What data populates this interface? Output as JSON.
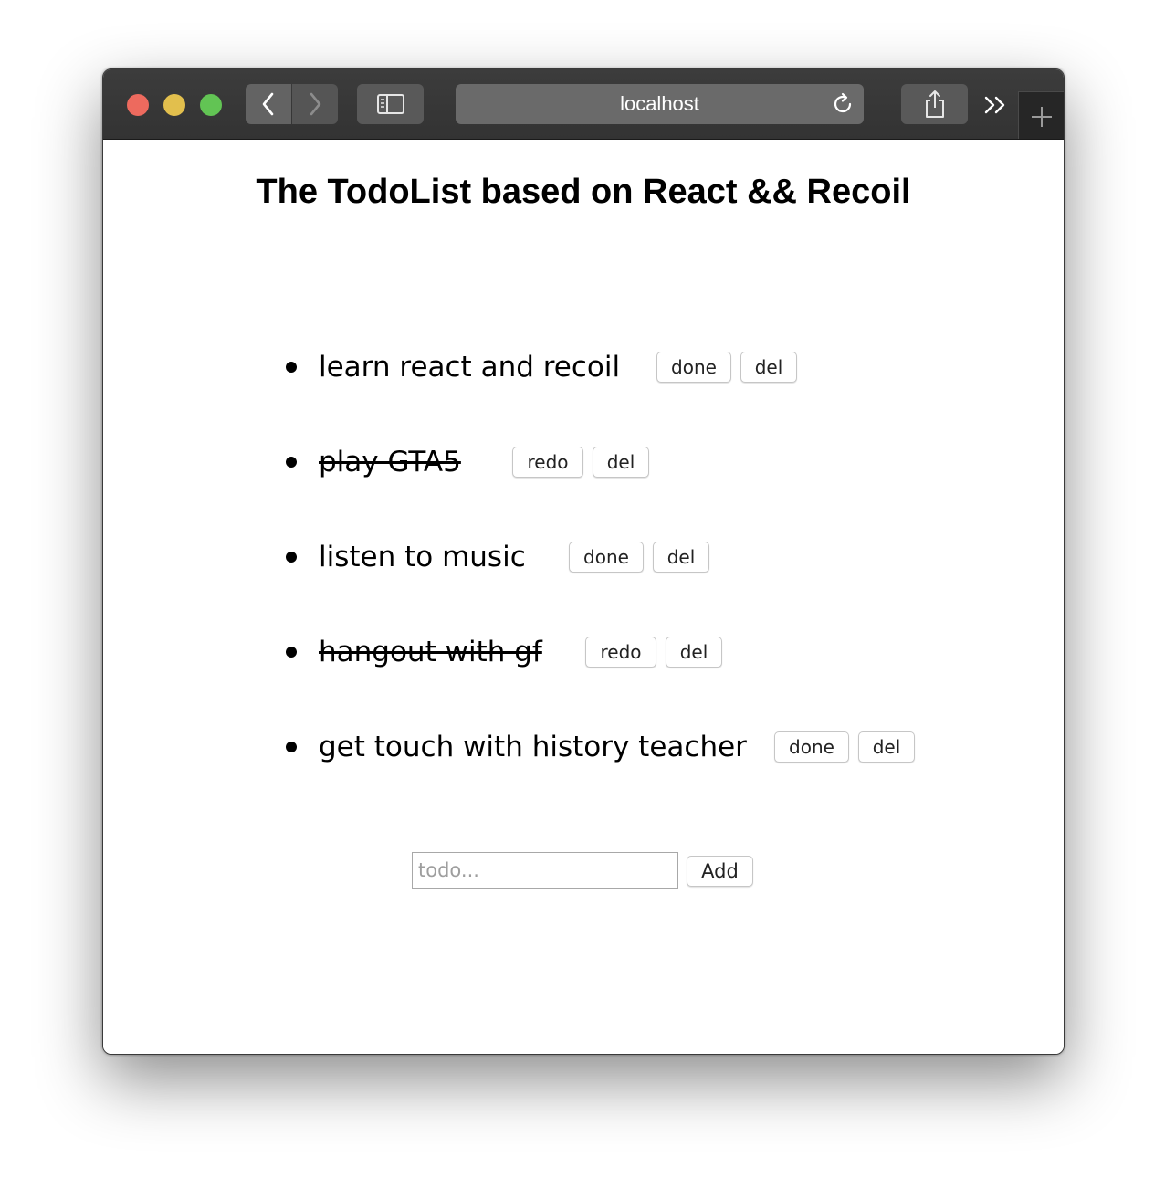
{
  "browser": {
    "url": "localhost",
    "icons": {
      "back": "chevron-left-icon",
      "forward": "chevron-right-icon",
      "sidebar": "sidebar-icon",
      "reload": "reload-icon",
      "share": "share-icon",
      "more": "double-chevron-icon",
      "new_tab": "plus-icon"
    },
    "colors": {
      "close": "#ed6a5e",
      "minimize": "#e2bf4d",
      "zoom": "#62c454"
    }
  },
  "page": {
    "title": "The TodoList based on React && Recoil",
    "todos": [
      {
        "text": "learn react and recoil",
        "completed": false,
        "action_label": "done",
        "delete_label": "del"
      },
      {
        "text": "play GTA5",
        "completed": true,
        "action_label": "redo",
        "delete_label": "del"
      },
      {
        "text": "listen to music",
        "completed": false,
        "action_label": "done",
        "delete_label": "del"
      },
      {
        "text": "hangout with gf",
        "completed": true,
        "action_label": "redo",
        "delete_label": "del"
      },
      {
        "text": "get touch with history teacher",
        "completed": false,
        "action_label": "done",
        "delete_label": "del"
      }
    ],
    "input": {
      "placeholder": "todo...",
      "value": ""
    },
    "add_label": "Add"
  }
}
